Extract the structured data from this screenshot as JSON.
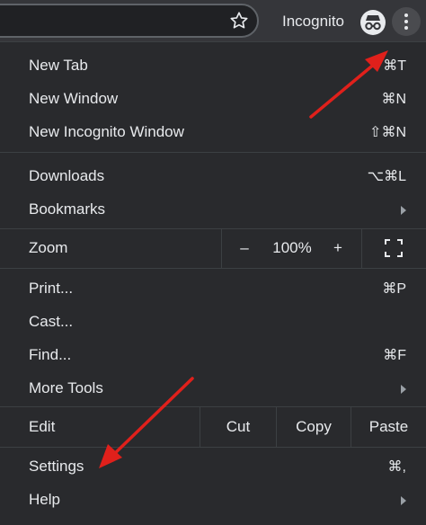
{
  "toolbar": {
    "incognito_label": "Incognito"
  },
  "menu": {
    "new_tab": {
      "label": "New Tab",
      "shortcut": "⌘T"
    },
    "new_window": {
      "label": "New Window",
      "shortcut": "⌘N"
    },
    "new_incognito": {
      "label": "New Incognito Window",
      "shortcut": "⇧⌘N"
    },
    "downloads": {
      "label": "Downloads",
      "shortcut": "⌥⌘L"
    },
    "bookmarks": {
      "label": "Bookmarks"
    },
    "zoom": {
      "label": "Zoom",
      "minus": "–",
      "value": "100%",
      "plus": "+"
    },
    "print": {
      "label": "Print...",
      "shortcut": "⌘P"
    },
    "cast": {
      "label": "Cast..."
    },
    "find": {
      "label": "Find...",
      "shortcut": "⌘F"
    },
    "more_tools": {
      "label": "More Tools"
    },
    "edit": {
      "label": "Edit",
      "cut": "Cut",
      "copy": "Copy",
      "paste": "Paste"
    },
    "settings": {
      "label": "Settings",
      "shortcut": "⌘,"
    },
    "help": {
      "label": "Help"
    }
  },
  "colors": {
    "annotation_arrow": "#e0201b",
    "menu_bg": "#292a2d",
    "toolbar_bg": "#35363a"
  }
}
